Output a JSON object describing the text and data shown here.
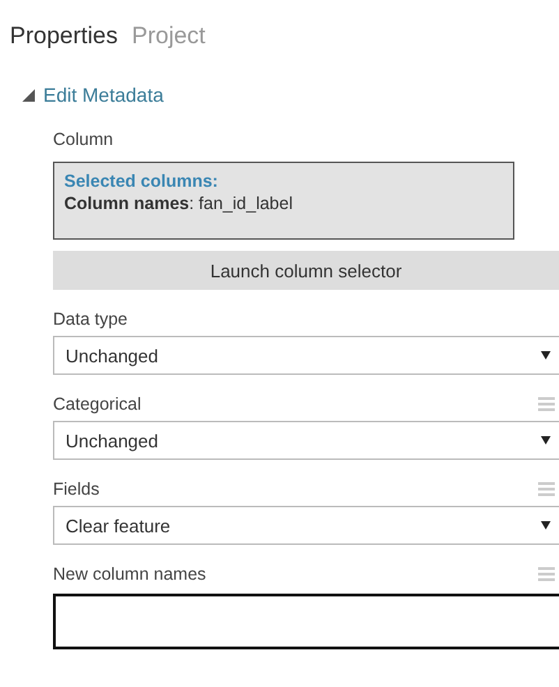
{
  "tabs": [
    {
      "label": "Properties",
      "selected": true
    },
    {
      "label": "Project",
      "selected": false
    }
  ],
  "section": {
    "title": "Edit Metadata",
    "expanded": true
  },
  "column": {
    "label": "Column",
    "heading": "Selected columns:",
    "names": "**Column names**: fan_id_label",
    "button": "Launch column selector"
  },
  "fields": [
    {
      "label": "Data type",
      "kind": "dropdown",
      "value": "Unchanged",
      "parameter_toggle": false
    },
    {
      "label": "Categorical",
      "kind": "dropdown",
      "value": "Unchanged",
      "parameter_toggle": true
    },
    {
      "label": "Fields",
      "kind": "dropdown",
      "value": "Clear feature",
      "parameter_toggle": true
    },
    {
      "label": "New column names",
      "kind": "textbox",
      "parameter_toggle": true
    }
  ]
}
